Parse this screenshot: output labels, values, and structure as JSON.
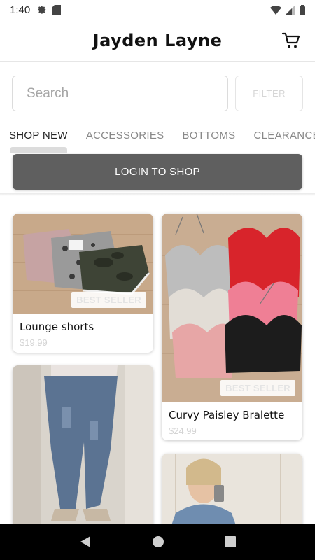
{
  "status": {
    "time": "1:40"
  },
  "app": {
    "title": "Jayden Layne"
  },
  "search": {
    "placeholder": "Search",
    "filter_label": "FILTER"
  },
  "tabs": [
    {
      "label": "SHOP NEW",
      "active": true
    },
    {
      "label": "ACCESSORIES",
      "active": false
    },
    {
      "label": "BOTTOMS",
      "active": false
    },
    {
      "label": "CLEARANCE",
      "active": false
    }
  ],
  "login": {
    "label": "LOGIN TO SHOP"
  },
  "products": [
    {
      "title": "Lounge shorts",
      "price": "$19.99",
      "badge": "BEST SELLER"
    },
    {
      "title": "Curvy Paisley Bralette",
      "price": "$24.99",
      "badge": "BEST SELLER"
    },
    {
      "title": "",
      "price": "",
      "badge": ""
    },
    {
      "title": "",
      "price": "",
      "badge": ""
    }
  ],
  "colors": {
    "login_button": "#5f5f5f",
    "price_text": "#d4d4d4",
    "badge_text": "#e4e4e4"
  }
}
